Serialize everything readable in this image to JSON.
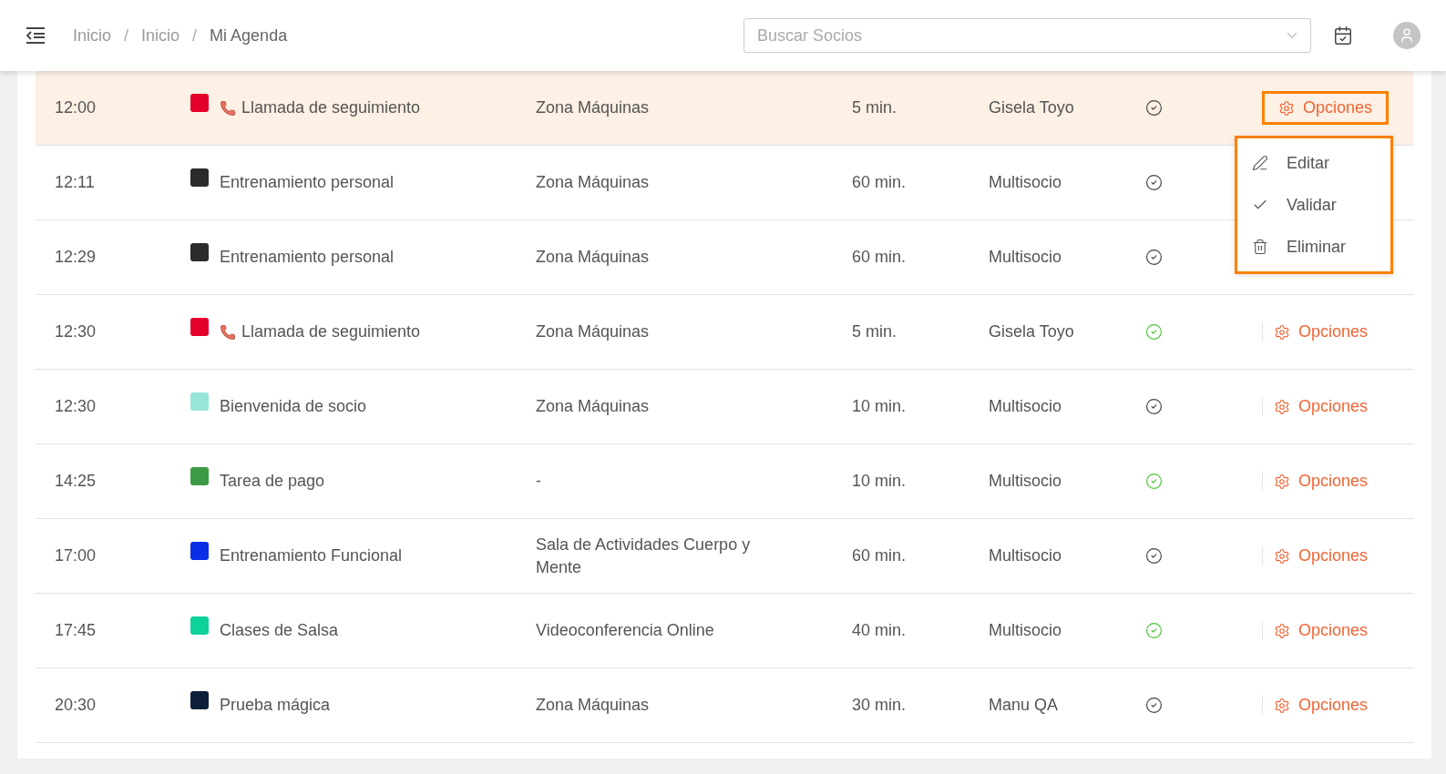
{
  "header": {
    "breadcrumb": [
      {
        "label": "Inicio",
        "selected": false
      },
      {
        "label": "Inicio",
        "selected": false
      },
      {
        "label": "Mi Agenda",
        "selected": true
      }
    ],
    "breadcrumb_separator": "/",
    "search": {
      "placeholder": "Buscar Socios"
    }
  },
  "rows": [
    {
      "time": "12:00",
      "color": "#e4002b",
      "kind": "call",
      "name": "Llamada de seguimiento",
      "location": "Zona Máquinas",
      "duration": "5 min.",
      "person": "Gisela Toyo",
      "validated": false,
      "selected": true,
      "options": "Opciones",
      "expanded": true,
      "menu": [
        {
          "kind": "edit",
          "label": "Editar"
        },
        {
          "kind": "validate",
          "label": "Validar"
        },
        {
          "kind": "delete",
          "label": "Eliminar"
        }
      ]
    },
    {
      "time": "12:11",
      "color": "#2b2b2b",
      "kind": "task",
      "name": "Entrenamiento personal",
      "location": "Zona Máquinas",
      "duration": "60 min.",
      "person": "Multisocio",
      "validated": false,
      "selected": false
    },
    {
      "time": "12:29",
      "color": "#2b2b2b",
      "kind": "task",
      "name": "Entrenamiento personal",
      "location": "Zona Máquinas",
      "duration": "60 min.",
      "person": "Multisocio",
      "validated": false,
      "selected": false
    },
    {
      "time": "12:30",
      "color": "#e4002b",
      "kind": "call",
      "name": "Llamada de seguimiento",
      "location": "Zona Máquinas",
      "duration": "5 min.",
      "person": "Gisela Toyo",
      "validated": true,
      "selected": false,
      "options": "Opciones",
      "expanded": false
    },
    {
      "time": "12:30",
      "color": "#97e6da",
      "kind": "task",
      "name": "Bienvenida de socio",
      "location": "Zona Máquinas",
      "duration": "10 min.",
      "person": "Multisocio",
      "validated": false,
      "selected": false,
      "options": "Opciones",
      "expanded": false
    },
    {
      "time": "14:25",
      "color": "#3c9a44",
      "kind": "task",
      "name": "Tarea de pago",
      "location": "-",
      "duration": "10 min.",
      "person": "Multisocio",
      "validated": true,
      "selected": false,
      "options": "Opciones",
      "expanded": false
    },
    {
      "time": "17:00",
      "color": "#0a2ee6",
      "kind": "task",
      "name": "Entrenamiento Funcional",
      "location": "Sala de Actividades Cuerpo y Mente",
      "duration": "60 min.",
      "person": "Multisocio",
      "validated": false,
      "selected": false,
      "options": "Opciones",
      "expanded": false
    },
    {
      "time": "17:45",
      "color": "#0fd19a",
      "kind": "task",
      "name": "Clases de Salsa",
      "location": "Videoconferencia Online",
      "duration": "40 min.",
      "person": "Multisocio",
      "validated": true,
      "selected": false,
      "options": "Opciones",
      "expanded": false
    },
    {
      "time": "20:30",
      "color": "#0f1f3a",
      "kind": "task",
      "name": "Prueba mágica",
      "location": "Zona Máquinas",
      "duration": "30 min.",
      "person": "Manu QA",
      "validated": false,
      "selected": false,
      "options": "Opciones",
      "expanded": false
    }
  ]
}
